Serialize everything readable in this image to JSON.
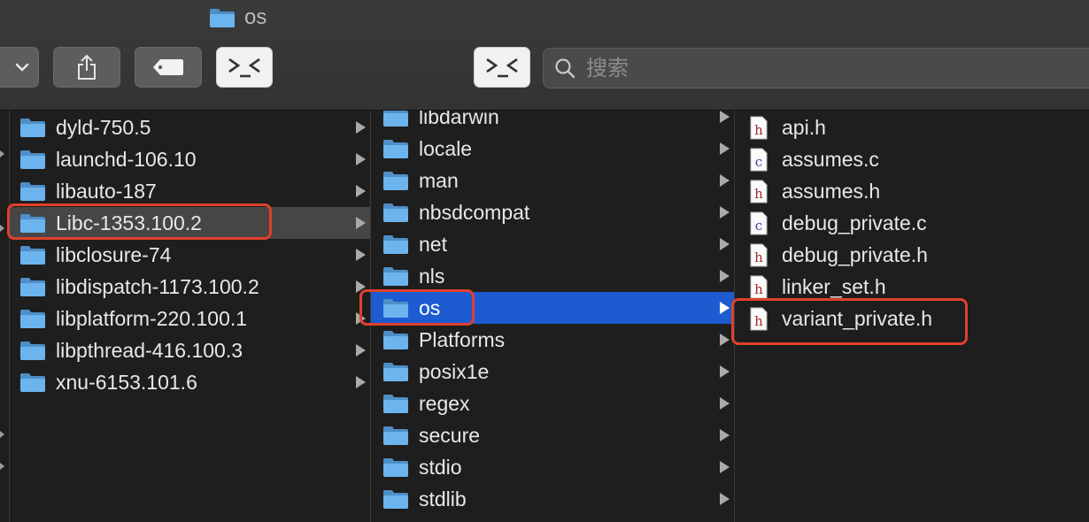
{
  "window": {
    "title": "os"
  },
  "toolbar": {
    "buttons": [
      {
        "name": "view-dropdown-button",
        "icon": "chevron-down-icon"
      },
      {
        "name": "share-button",
        "icon": "share-icon"
      },
      {
        "name": "tag-button",
        "icon": "tag-icon"
      },
      {
        "name": "terminal-button",
        "icon": "terminal-icon"
      },
      {
        "name": "terminal-button-2",
        "icon": "terminal-icon"
      }
    ],
    "search": {
      "placeholder": "搜索",
      "value": ""
    }
  },
  "columns": {
    "col1": {
      "items": [
        "dyld-750.5",
        "launchd-106.10",
        "libauto-187",
        "Libc-1353.100.2",
        "libclosure-74",
        "libdispatch-1173.100.2",
        "libplatform-220.100.1",
        "libpthread-416.100.3",
        "xnu-6153.101.6"
      ],
      "selected": "Libc-1353.100.2"
    },
    "col2": {
      "items": [
        "libdarwin",
        "locale",
        "man",
        "nbsdcompat",
        "net",
        "nls",
        "os",
        "Platforms",
        "posix1e",
        "regex",
        "secure",
        "stdio",
        "stdlib"
      ],
      "selected": "os"
    },
    "col3": {
      "items": [
        {
          "name": "api.h",
          "type": "h"
        },
        {
          "name": "assumes.c",
          "type": "c"
        },
        {
          "name": "assumes.h",
          "type": "h"
        },
        {
          "name": "debug_private.c",
          "type": "c"
        },
        {
          "name": "debug_private.h",
          "type": "h"
        },
        {
          "name": "linker_set.h",
          "type": "h"
        },
        {
          "name": "variant_private.h",
          "type": "h"
        }
      ]
    }
  },
  "colors": {
    "selection_blue": "#1d5bd1",
    "selection_grey": "#464646",
    "highlight_red": "#e0402c",
    "folder_blue": "#5aa9e6"
  }
}
